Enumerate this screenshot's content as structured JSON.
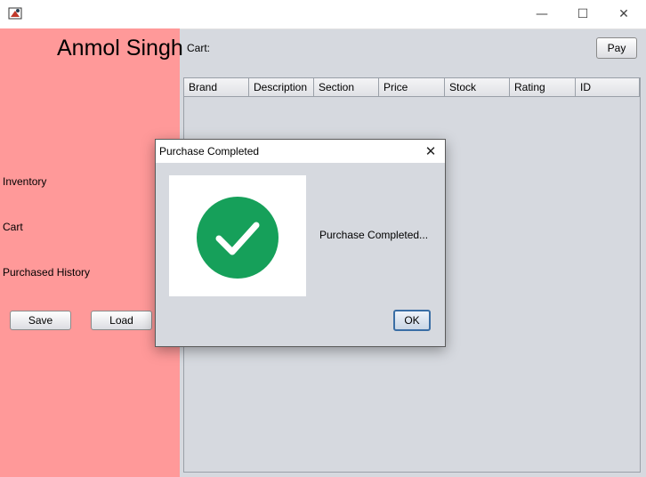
{
  "window": {
    "minimize_glyph": "—",
    "maximize_glyph": "☐",
    "close_glyph": "✕"
  },
  "sidebar": {
    "user_name": "Anmol Singh",
    "links": [
      "Inventory",
      "Cart",
      "Purchased History"
    ],
    "save_label": "Save",
    "load_label": "Load",
    "background_color": "#ff9999"
  },
  "main": {
    "cart_label": "Cart:",
    "pay_label": "Pay",
    "table_columns": [
      "Brand",
      "Description",
      "Section",
      "Price",
      "Stock",
      "Rating",
      "ID"
    ]
  },
  "dialog": {
    "title": "Purchase Completed",
    "message": "Purchase Completed...",
    "ok_label": "OK",
    "close_glyph": "✕",
    "icon": "check-circle-icon",
    "icon_color": "#16a05a"
  }
}
